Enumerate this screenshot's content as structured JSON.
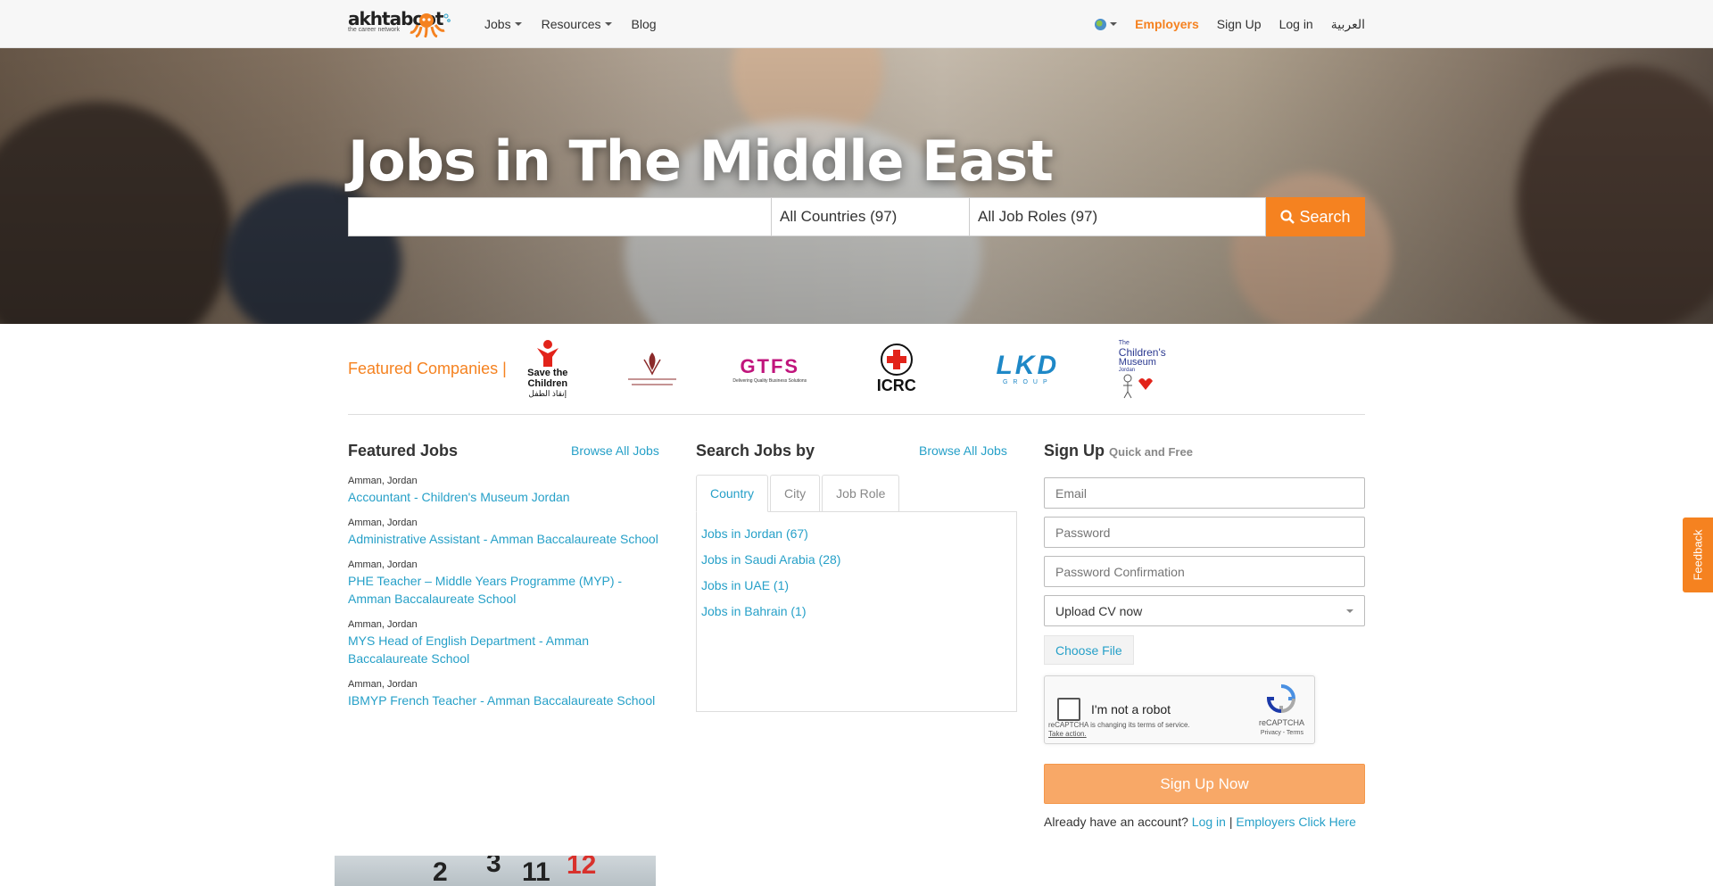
{
  "nav": {
    "logo_word": "akhtaboot",
    "logo_tagline": "the career network",
    "items": [
      "Jobs",
      "Resources",
      "Blog"
    ],
    "employers": "Employers",
    "signup": "Sign Up",
    "login": "Log in",
    "arabic": "العربية"
  },
  "hero": {
    "title": "Jobs in The Middle East",
    "keyword_placeholder": "",
    "country_select": "All Countries (97)",
    "role_select": "All Job Roles (97)",
    "search_button": "Search"
  },
  "featured_companies": {
    "title": "Featured Companies |",
    "logos": [
      "Save the Children",
      "Amman Baccalaureate School",
      "GTFS",
      "ICRC",
      "LKD",
      "The Children's Museum Jordan"
    ],
    "save_the_children_lines": [
      "Save the",
      "Children",
      "إنقاذ الطفل"
    ],
    "gtfs_text": "GTFS",
    "gtfs_tagline": "Delivering Quality Business Solutions",
    "icrc_text": "ICRC",
    "lkd_text": "LKD",
    "lkd_sub": "GROUP",
    "museum_lines": [
      "The",
      "Children's",
      "Museum",
      "Jordan"
    ]
  },
  "featured_jobs": {
    "title": "Featured Jobs",
    "browse": "Browse All Jobs",
    "jobs": [
      {
        "location": "Amman, Jordan",
        "title": "Accountant - Children's Museum Jordan"
      },
      {
        "location": "Amman, Jordan",
        "title": "Administrative Assistant - Amman Baccalaureate School"
      },
      {
        "location": "Amman, Jordan",
        "title": "PHE Teacher – Middle Years Programme (MYP) - Amman Baccalaureate School"
      },
      {
        "location": "Amman, Jordan",
        "title": "MYS Head of English Department - Amman Baccalaureate School"
      },
      {
        "location": "Amman, Jordan",
        "title": "IBMYP French Teacher - Amman Baccalaureate School"
      }
    ]
  },
  "search_jobs": {
    "title": "Search Jobs by",
    "browse": "Browse All Jobs",
    "tabs": [
      "Country",
      "City",
      "Job Role"
    ],
    "links": [
      "Jobs in Jordan (67)",
      "Jobs in Saudi Arabia (28)",
      "Jobs in UAE (1)",
      "Jobs in Bahrain (1)"
    ]
  },
  "signup": {
    "title": "Sign Up",
    "subtitle": "Quick and Free",
    "email_placeholder": "Email",
    "password_placeholder": "Password",
    "password_confirm_placeholder": "Password Confirmation",
    "cv_select": "Upload CV now",
    "choose_file": "Choose File",
    "captcha_label": "I'm not a robot",
    "captcha_note": "reCAPTCHA is changing its terms of service.",
    "captcha_action": "Take action.",
    "captcha_brand": "reCAPTCHA",
    "captcha_terms": "Privacy - Terms",
    "button": "Sign Up Now",
    "already": "Already have an account?",
    "login_link": "Log in",
    "separator": "|",
    "employers_link": "Employers Click Here"
  },
  "feedback": "Feedback",
  "calendar_numbers": [
    "2",
    "3",
    "11",
    "12"
  ],
  "colors": {
    "accent": "#f58220",
    "link": "#26a0c8"
  }
}
